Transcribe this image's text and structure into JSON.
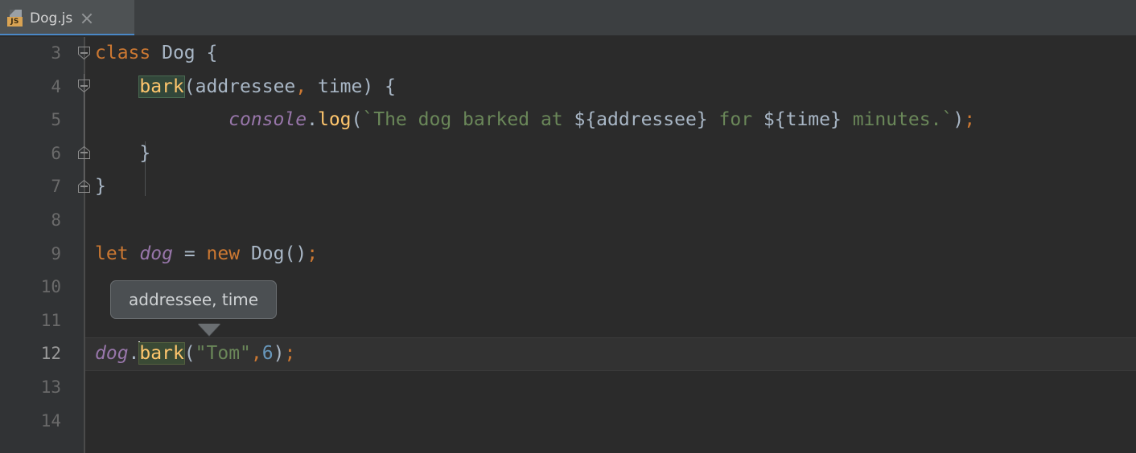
{
  "window": {
    "theme": "darcula",
    "accent_color": "#4a88c7",
    "editor_background": "#2b2b2b",
    "gutter_background": "#313335"
  },
  "tabbar": {
    "tabs": [
      {
        "label": "Dog.js",
        "icon": "javascript-file-icon",
        "badge_text": "JS",
        "active": true,
        "close_icon": "close-icon"
      }
    ]
  },
  "editor": {
    "language": "JavaScript",
    "caret_line": 12,
    "caret_column": 5,
    "lines": [
      {
        "number": "3",
        "fold": "start"
      },
      {
        "number": "4",
        "fold": "start"
      },
      {
        "number": "5",
        "fold": "none"
      },
      {
        "number": "6",
        "fold": "end"
      },
      {
        "number": "7",
        "fold": "end"
      },
      {
        "number": "8",
        "fold": "none"
      },
      {
        "number": "9",
        "fold": "none"
      },
      {
        "number": "10",
        "fold": "none"
      },
      {
        "number": "11",
        "fold": "none"
      },
      {
        "number": "12",
        "fold": "none"
      },
      {
        "number": "13",
        "fold": "none"
      },
      {
        "number": "14",
        "fold": "none"
      }
    ],
    "code": {
      "l3": {
        "kw": "class",
        "sp1": " ",
        "cls": "Dog",
        "sp2": " ",
        "brace": "{"
      },
      "l4": {
        "indent": "    ",
        "fn": "bark",
        "open": "(",
        "p1": "addressee",
        "comma": ",",
        "sp": " ",
        "p2": "time",
        "close": ")",
        "sp2": " ",
        "brace": "{"
      },
      "l5": {
        "indent": "            ",
        "obj": "console",
        "dot": ".",
        "method": "log",
        "open": "(",
        "tick1": "`",
        "t1": "The dog barked at ",
        "i1": "${addressee}",
        "t2": " for ",
        "i2": "${time}",
        "t3": " minutes.",
        "tick2": "`",
        "close": ")",
        "semi": ";"
      },
      "l6": {
        "indent": "    ",
        "brace": "}"
      },
      "l7": {
        "brace": "}"
      },
      "l8": {
        "text": ""
      },
      "l9": {
        "kw1": "let",
        "sp1": " ",
        "var": "dog",
        "sp2": " ",
        "eq": "=",
        "sp3": " ",
        "kw2": "new",
        "sp4": " ",
        "cls": "Dog",
        "parens": "()",
        "semi": ";"
      },
      "l10": {
        "text": ""
      },
      "l11": {
        "text": ""
      },
      "l12": {
        "var": "dog",
        "dot": ".",
        "fn": "bark",
        "open": "(",
        "str": "\"Tom\"",
        "comma": ",",
        "num": "6",
        "close": ")",
        "semi": ";"
      },
      "l13": {
        "text": ""
      },
      "l14": {
        "text": ""
      }
    }
  },
  "tooltip": {
    "text": "addressee, time",
    "kind": "parameter-info"
  }
}
